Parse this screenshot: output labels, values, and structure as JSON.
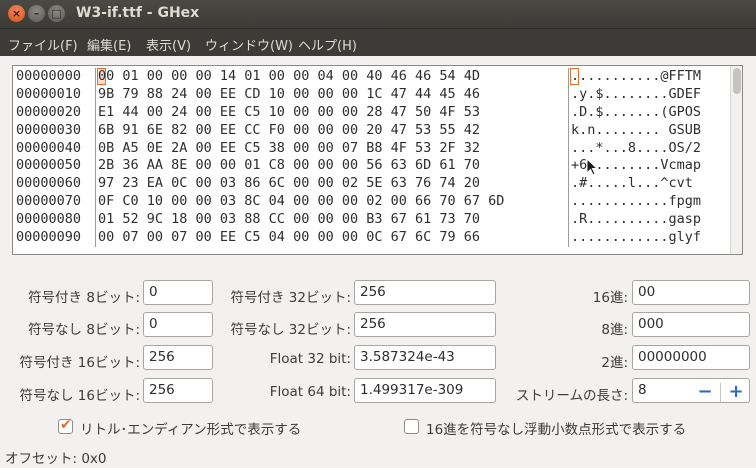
{
  "window": {
    "title": "W3-if.ttf - GHex",
    "close_glyph": "×",
    "min_glyph": "–",
    "max_glyph": "□"
  },
  "menu": {
    "file": "ファイル(F)",
    "edit": "編集(E)",
    "view": "表示(V)",
    "window": "ウィンドウ(W)",
    "help": "ヘルプ(H)"
  },
  "hex": {
    "offsets": [
      "00000000",
      "00000010",
      "00000020",
      "00000030",
      "00000040",
      "00000050",
      "00000060",
      "00000070",
      "00000080",
      "00000090"
    ],
    "hex_rows": [
      "00 01 00 00 00 14 01 00 00 04 00 40 46 46 54 4D",
      "9B 79 88 24 00 EE CD 10 00 00 00 1C 47 44 45 46",
      "E1 44 00 24 00 EE C5 10 00 00 00 28 47 50 4F 53",
      "6B 91 6E 82 00 EE CC F0 00 00 00 20 47 53 55 42",
      "0B A5 0E 2A 00 EE C5 38 00 00 07 B8 4F 53 2F 32",
      "2B 36 AA 8E 00 00 01 C8 00 00 00 56 63 6D 61 70",
      "97 23 EA 0C 00 03 86 6C 00 00 02 5E 63 76 74 20",
      "0F C0 10 00 00 03 8C 04 00 00 00 02 00 66 70 67 6D",
      "01 52 9C 18 00 03 88 CC 00 00 00 B3 67 61 73 70",
      "00 07 00 07 00 EE C5 04 00 00 00 0C 67 6C 79 66"
    ],
    "ascii_rows": [
      "...........@FFTM",
      ".y.$........GDEF",
      ".D.$.......(GPOS",
      "k.n........ GSUB",
      "...*...8....OS/2",
      "+6.........Vcmap",
      ".#.....l...^cvt ",
      "............fpgm",
      ".R..........gasp",
      "............glyf"
    ]
  },
  "fields": {
    "signed8_label": "符号付き 8ビット:",
    "signed8_value": "0",
    "unsigned8_label": "符号なし 8ビット:",
    "unsigned8_value": "0",
    "signed16_label": "符号付き 16ビット:",
    "signed16_value": "256",
    "unsigned16_label": "符号なし 16ビット:",
    "unsigned16_value": "256",
    "signed32_label": "符号付き 32ビット:",
    "signed32_value": "256",
    "unsigned32_label": "符号なし 32ビット:",
    "unsigned32_value": "256",
    "float32_label": "Float 32 bit:",
    "float32_value": "3.587324e-43",
    "float64_label": "Float 64 bit:",
    "float64_value": "1.499317e-309",
    "hex_label": "16進:",
    "hex_value": "00",
    "oct_label": "8進:",
    "oct_value": "000",
    "bin_label": "2進:",
    "bin_value": "00000000",
    "stream_label": "ストリームの長さ:",
    "stream_value": "8",
    "minus_glyph": "−",
    "plus_glyph": "+"
  },
  "options": {
    "little_endian_label": "リトル･エンディアン形式で表示する",
    "little_endian_checked": true,
    "unsigned_hex_float_label": "16進を符号なし浮動小数点形式で表示する",
    "unsigned_hex_float_checked": false,
    "check_glyph": "✔"
  },
  "status": {
    "offset_text": "オフセット: 0x0"
  },
  "colors": {
    "accent": "#e0702f",
    "menubar_bg": "#3c3b37",
    "spin_blue": "#2a6fb8"
  }
}
